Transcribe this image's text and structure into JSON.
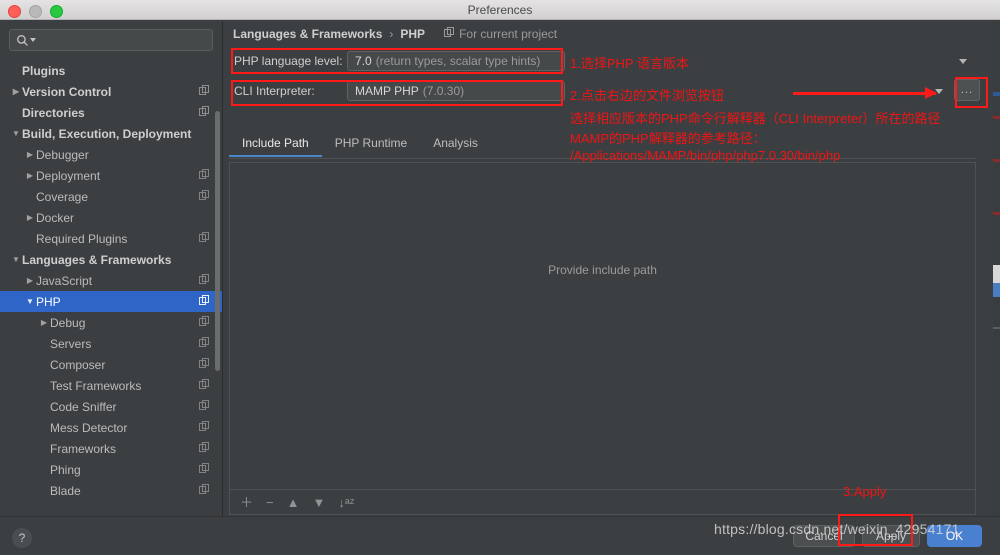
{
  "window": {
    "title": "Preferences",
    "traffic_lights": [
      "close",
      "minimize",
      "maximize"
    ]
  },
  "sidebar": {
    "search": {
      "value": "",
      "placeholder": ""
    },
    "items": [
      {
        "label": "Plugins",
        "indent": 0,
        "arrow": "none",
        "bold": true,
        "copy": false,
        "selected": false
      },
      {
        "label": "Version Control",
        "indent": 0,
        "arrow": "right",
        "bold": true,
        "copy": true,
        "selected": false
      },
      {
        "label": "Directories",
        "indent": 0,
        "arrow": "none",
        "bold": true,
        "copy": true,
        "selected": false
      },
      {
        "label": "Build, Execution, Deployment",
        "indent": 0,
        "arrow": "down",
        "bold": true,
        "copy": false,
        "selected": false
      },
      {
        "label": "Debugger",
        "indent": 1,
        "arrow": "right",
        "bold": false,
        "copy": false,
        "selected": false
      },
      {
        "label": "Deployment",
        "indent": 1,
        "arrow": "right",
        "bold": false,
        "copy": true,
        "selected": false
      },
      {
        "label": "Coverage",
        "indent": 1,
        "arrow": "none",
        "bold": false,
        "copy": true,
        "selected": false
      },
      {
        "label": "Docker",
        "indent": 1,
        "arrow": "right",
        "bold": false,
        "copy": false,
        "selected": false
      },
      {
        "label": "Required Plugins",
        "indent": 1,
        "arrow": "none",
        "bold": false,
        "copy": true,
        "selected": false
      },
      {
        "label": "Languages & Frameworks",
        "indent": 0,
        "arrow": "down",
        "bold": true,
        "copy": false,
        "selected": false
      },
      {
        "label": "JavaScript",
        "indent": 1,
        "arrow": "right",
        "bold": false,
        "copy": true,
        "selected": false
      },
      {
        "label": "PHP",
        "indent": 1,
        "arrow": "down",
        "bold": false,
        "copy": true,
        "selected": true
      },
      {
        "label": "Debug",
        "indent": 2,
        "arrow": "right",
        "bold": false,
        "copy": true,
        "selected": false
      },
      {
        "label": "Servers",
        "indent": 2,
        "arrow": "none",
        "bold": false,
        "copy": true,
        "selected": false
      },
      {
        "label": "Composer",
        "indent": 2,
        "arrow": "none",
        "bold": false,
        "copy": true,
        "selected": false
      },
      {
        "label": "Test Frameworks",
        "indent": 2,
        "arrow": "none",
        "bold": false,
        "copy": true,
        "selected": false
      },
      {
        "label": "Code Sniffer",
        "indent": 2,
        "arrow": "none",
        "bold": false,
        "copy": true,
        "selected": false
      },
      {
        "label": "Mess Detector",
        "indent": 2,
        "arrow": "none",
        "bold": false,
        "copy": true,
        "selected": false
      },
      {
        "label": "Frameworks",
        "indent": 2,
        "arrow": "none",
        "bold": false,
        "copy": true,
        "selected": false
      },
      {
        "label": "Phing",
        "indent": 2,
        "arrow": "none",
        "bold": false,
        "copy": true,
        "selected": false
      },
      {
        "label": "Blade",
        "indent": 2,
        "arrow": "none",
        "bold": false,
        "copy": true,
        "selected": false
      }
    ]
  },
  "main": {
    "breadcrumb": {
      "root": "Languages & Frameworks",
      "separator": "›",
      "leaf": "PHP"
    },
    "scope_label": "For current project",
    "php_language_level": {
      "label": "PHP language level:",
      "value": "7.0",
      "value_hint": "(return types, scalar type hints)"
    },
    "cli_interpreter": {
      "label": "CLI Interpreter:",
      "value": "MAMP PHP",
      "value_hint": "(7.0.30)",
      "browse_label": "..."
    },
    "tabs": [
      {
        "label": "Include Path",
        "active": true
      },
      {
        "label": "PHP Runtime",
        "active": false
      },
      {
        "label": "Analysis",
        "active": false
      }
    ],
    "include_path": {
      "empty_text": "Provide include path",
      "toolbar": [
        {
          "icon": "plus-icon",
          "glyph": "＋"
        },
        {
          "icon": "minus-icon",
          "glyph": "−"
        },
        {
          "icon": "move-up-icon",
          "glyph": "▲"
        },
        {
          "icon": "move-down-icon",
          "glyph": "▼"
        },
        {
          "icon": "sort-az-icon",
          "glyph": "↓ᵃᶻ"
        }
      ]
    }
  },
  "footer": {
    "help_label": "?",
    "buttons": [
      {
        "label": "Cancel",
        "primary": false
      },
      {
        "label": "Apply",
        "primary": false
      },
      {
        "label": "OK",
        "primary": true
      }
    ]
  },
  "annotations": {
    "step1": "1.选择PHP 语言版本",
    "step2": "2.点击右边的文件浏览按钮",
    "note1": "选择相应版本的PHP命令行解释器（CLI Interpreter）所在的路径",
    "note2": "MAMP的PHP解释器的参考路径：",
    "note3": "/Applications/MAMP/bin/php/php7.0.30/bin/php",
    "step3": "3.Apply",
    "color": "#ff1a1a"
  },
  "watermark": {
    "text": "https://blog.csdn.net/weixin_42954171"
  }
}
